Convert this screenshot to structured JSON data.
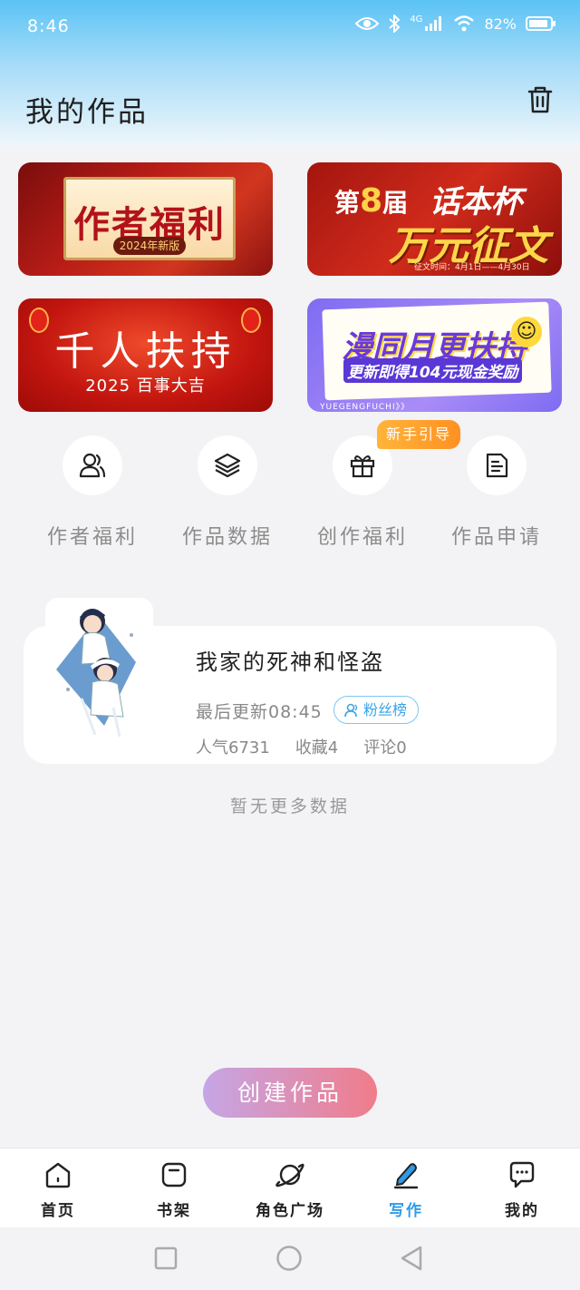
{
  "status_bar": {
    "time": "8:46",
    "network": "4G",
    "battery": "82%"
  },
  "header": {
    "title": "我的作品",
    "delete_icon": "trash-icon"
  },
  "banners": [
    {
      "title": "作者福利",
      "subtitle": "2024年新版"
    },
    {
      "line1_prefix": "第",
      "line1_number": "8",
      "line1_suffix": "届",
      "line1_title": "话本杯",
      "line2": "万元征文",
      "line3": "征文时间：4月1日——4月30日"
    },
    {
      "title": "千人扶持",
      "subtitle": "2025 百事大吉"
    },
    {
      "line1": "漫同月更扶持",
      "line2": "更新即得104元现金奖励",
      "footer": "YUEGENGFUCHI》》"
    }
  ],
  "features": [
    {
      "label": "作者福利",
      "icon": "users-icon"
    },
    {
      "label": "作品数据",
      "icon": "layers-icon"
    },
    {
      "label": "创作福利",
      "icon": "gift-icon"
    },
    {
      "label": "作品申请",
      "icon": "document-icon"
    }
  ],
  "guide_badge": "新手引导",
  "work": {
    "title": "我家的死神和怪盗",
    "update_label": "最后更新08:45",
    "fans_badge": "粉丝榜",
    "popularity": "人气6731",
    "favorites": "收藏4",
    "comments": "评论0"
  },
  "no_more": "暂无更多数据",
  "create_button": "创建作品",
  "tabs": [
    {
      "label": "首页",
      "icon": "home-icon",
      "active": false
    },
    {
      "label": "书架",
      "icon": "bookshelf-icon",
      "active": false
    },
    {
      "label": "角色广场",
      "icon": "planet-icon",
      "active": false
    },
    {
      "label": "写作",
      "icon": "pen-icon",
      "active": true
    },
    {
      "label": "我的",
      "icon": "chat-icon",
      "active": false
    }
  ],
  "colors": {
    "accent": "#2f9ae8",
    "badge": "#ff9a26"
  }
}
